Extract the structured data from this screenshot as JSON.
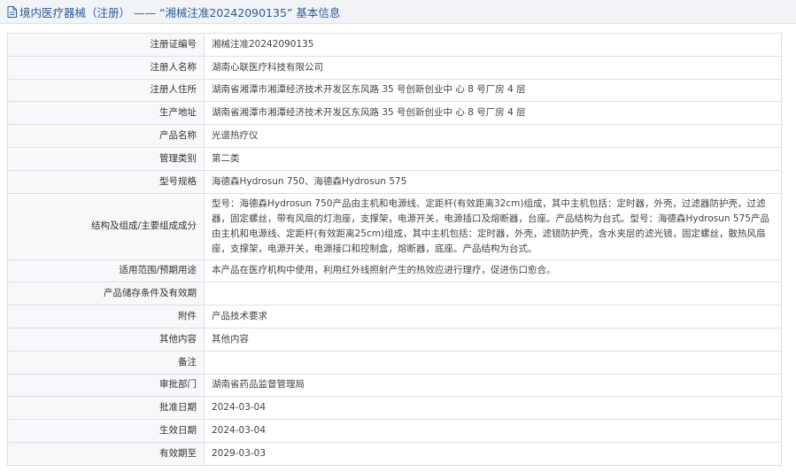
{
  "header": {
    "title": "境内医疗器械（注册） —— “湘械注准20242090135” 基本信息",
    "icon": "document-icon"
  },
  "colors": {
    "header_text": "#2a5c9a",
    "header_bg": "#f1f3f6",
    "label_bg": "#f7f8fa",
    "border": "#dcdfe6"
  },
  "rows": [
    {
      "label": "注册证编号",
      "value": "湘械注准20242090135"
    },
    {
      "label": "注册人名称",
      "value": "湖南心联医疗科技有限公司"
    },
    {
      "label": "注册人住所",
      "value": "湖南省湘潭市湘潭经济技术开发区东风路 35 号创新创业中 心 8 号厂房 4 层"
    },
    {
      "label": "生产地址",
      "value": "湖南省湘潭市湘潭经济技术开发区东风路 35 号创新创业中 心 8 号厂房 4 层"
    },
    {
      "label": "产品名称",
      "value": "光谱热疗仪"
    },
    {
      "label": "管理类别",
      "value": "第二类"
    },
    {
      "label": "型号规格",
      "value": "海德森Hydrosun 750、海德森Hydrosun 575"
    },
    {
      "label": "结构及组成/主要组成成分",
      "value": "型号：海德森Hydrosun 750产品由主机和电源线、定距杆(有效距离32cm)组成，其中主机包括：定时器，外壳，过滤器防护壳，过滤器，固定螺丝，带有风扇的灯泡座，支撑架，电源开关，电源插口及熔断器，台座。产品结构为台式。型号：海德森Hydrosun 575产品由主机和电源线、定距杆(有效距离25cm)组成，其中主机包括：定时器，外壳，滤镜防护壳，含水夹层的滤光镜，固定螺丝，散热风扇座，支撑架，电源开关，电源接口和控制盒，熔断器，底座。产品结构为台式。"
    },
    {
      "label": "适用范围/预期用途",
      "value": "本产品在医疗机构中使用，利用红外线照射产生的热效应进行理疗，促进伤口愈合。"
    },
    {
      "label": "产品储存条件及有效期",
      "value": ""
    },
    {
      "label": "附件",
      "value": "产品技术要求"
    },
    {
      "label": "其他内容",
      "value": "其他内容"
    },
    {
      "label": "备注",
      "value": ""
    },
    {
      "label": "审批部门",
      "value": "湖南省药品监督管理局"
    },
    {
      "label": "批准日期",
      "value": "2024-03-04"
    },
    {
      "label": "生效日期",
      "value": "2024-03-04"
    },
    {
      "label": "有效期至",
      "value": "2029-03-03"
    }
  ]
}
